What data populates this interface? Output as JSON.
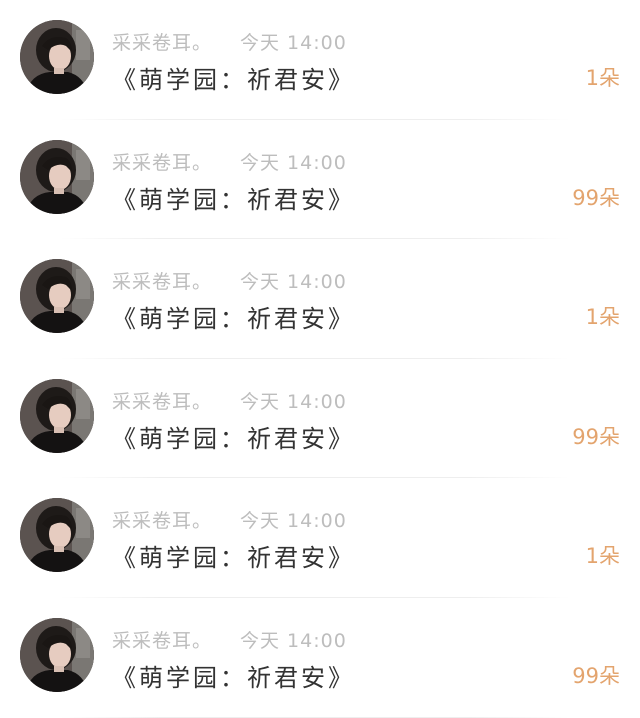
{
  "comments": [
    {
      "username": "采采卷耳。",
      "time": "今天 14:00",
      "content": "《萌学园：祈君安》",
      "count": "1朵"
    },
    {
      "username": "采采卷耳。",
      "time": "今天 14:00",
      "content": "《萌学园：祈君安》",
      "count": "99朵"
    },
    {
      "username": "采采卷耳。",
      "time": "今天 14:00",
      "content": "《萌学园：祈君安》",
      "count": "1朵"
    },
    {
      "username": "采采卷耳。",
      "time": "今天 14:00",
      "content": "《萌学园：祈君安》",
      "count": "99朵"
    },
    {
      "username": "采采卷耳。",
      "time": "今天 14:00",
      "content": "《萌学园：祈君安》",
      "count": "1朵"
    },
    {
      "username": "采采卷耳。",
      "time": "今天 14:00",
      "content": "《萌学园：祈君安》",
      "count": "99朵"
    }
  ],
  "colors": {
    "username": "#bdbdbd",
    "content": "#333333",
    "count": "#e3a46e"
  },
  "avatar_icon": "user-avatar-photo"
}
